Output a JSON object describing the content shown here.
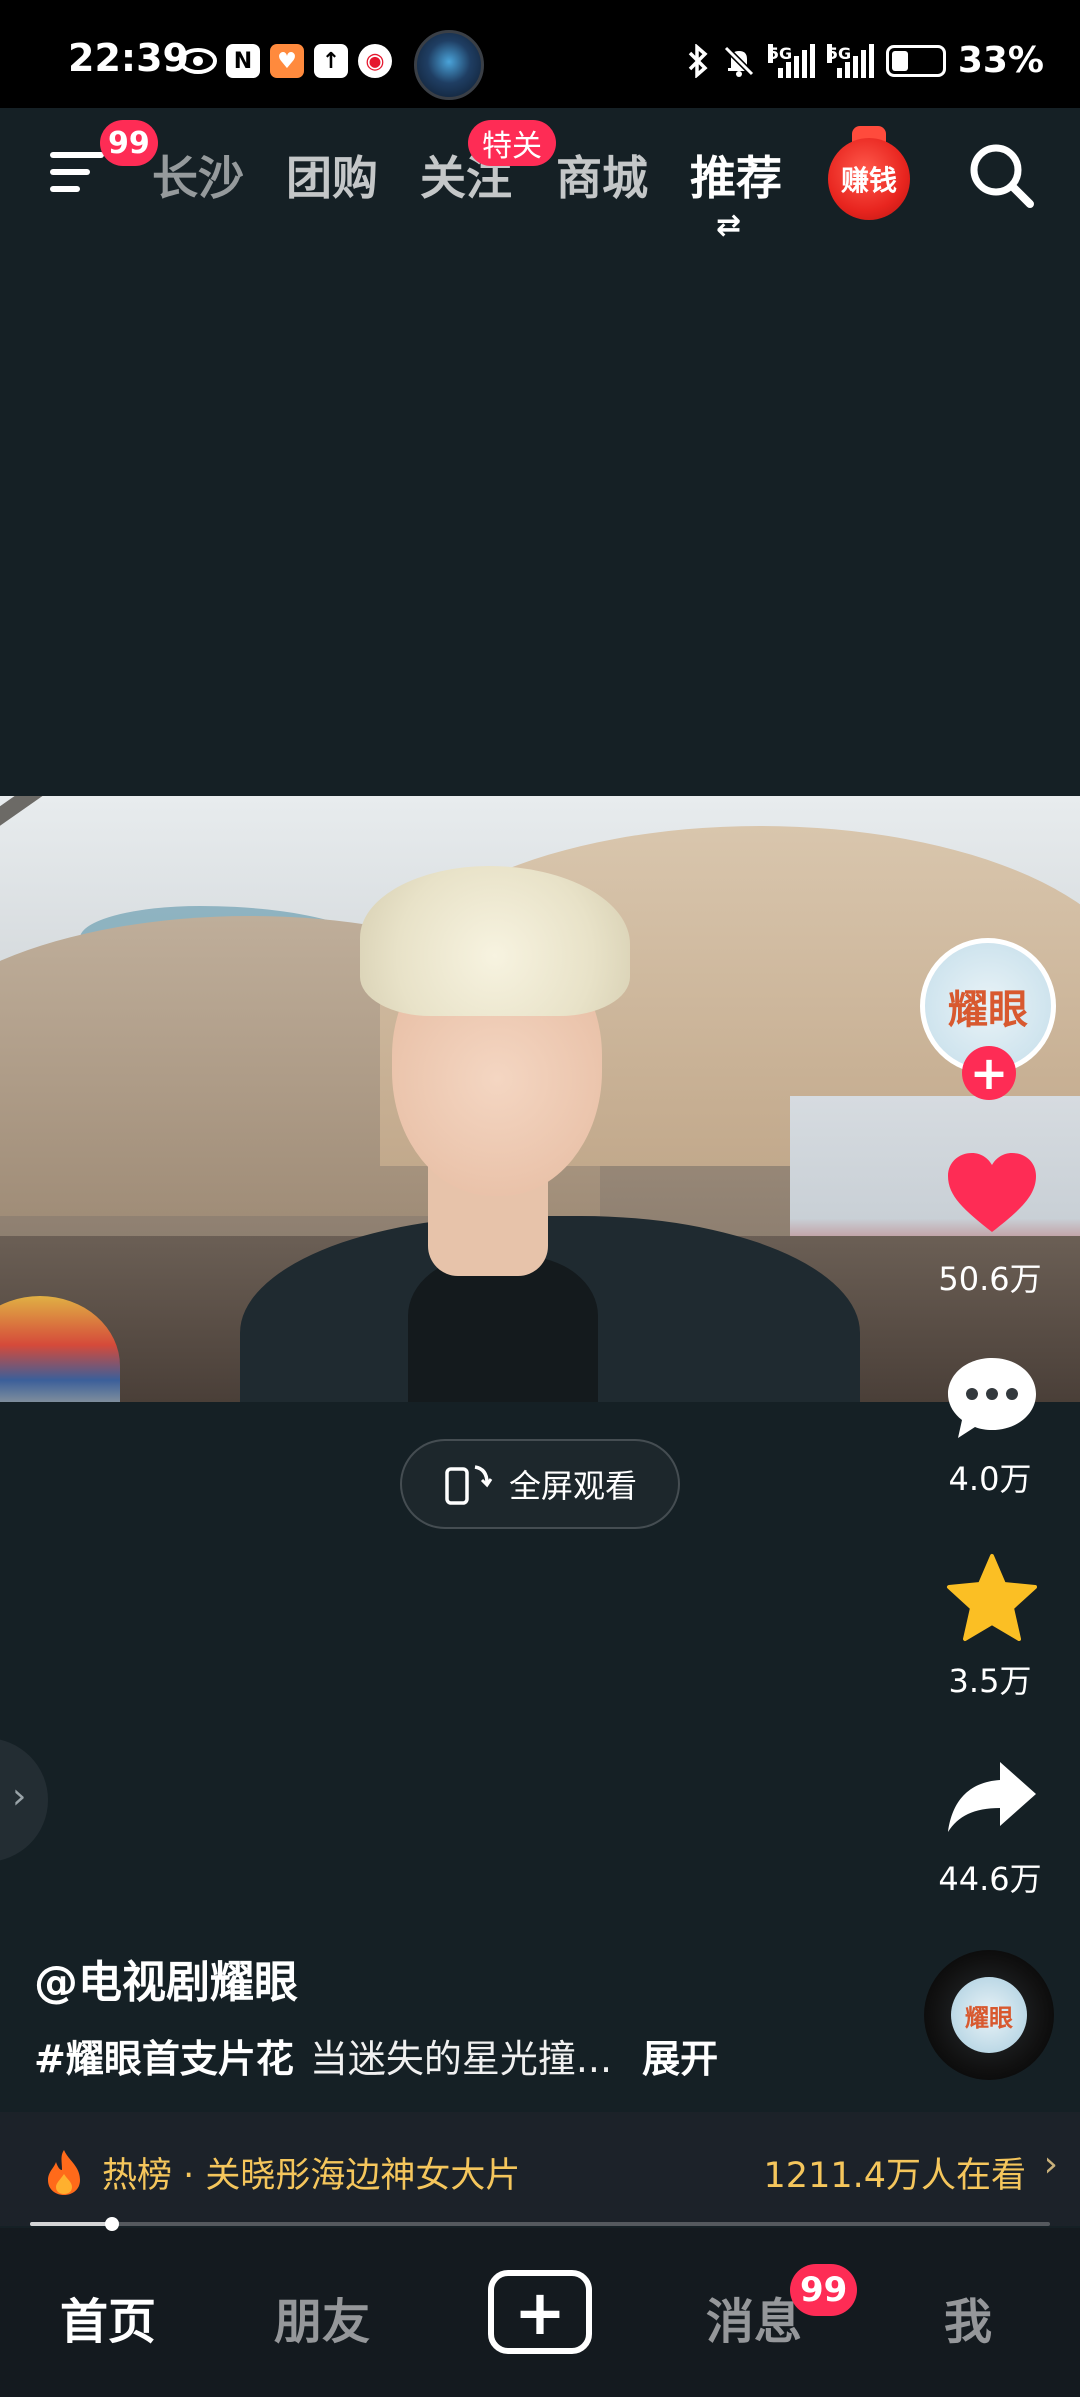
{
  "status_bar": {
    "time": "22:39",
    "battery": "33%",
    "battery_level": 0.33,
    "network_1": "5G",
    "network_2": "5G",
    "icons": [
      "eye-icon",
      "nfc-icon",
      "shop-app-icon",
      "upload-icon",
      "weibo-icon",
      "app-avatar-icon",
      "bluetooth-icon",
      "silent-icon",
      "signal-icon",
      "battery-icon"
    ]
  },
  "top_nav": {
    "menu_badge": "99",
    "tabs": [
      "长沙",
      "团购",
      "关注",
      "商城",
      "推荐"
    ],
    "follow_badge": "特关",
    "switch_glyph": "⇄",
    "earn_label": "赚钱"
  },
  "video": {
    "fullscreen_label": "全屏观看"
  },
  "actions": {
    "avatar_text": "耀眼",
    "likes": "50.6万",
    "comments": "4.0万",
    "favorites": "3.5万",
    "shares": "44.6万",
    "colors": {
      "like": "#fe2c55",
      "star": "#fbbf24",
      "follow": "#fe2c55"
    }
  },
  "caption": {
    "author": "@电视剧耀眼",
    "hashtag": "#耀眼首支片花",
    "text": "当迷失的星光撞...",
    "expand": "展开"
  },
  "music": {
    "disc_text": "耀眼"
  },
  "hot_board": {
    "text": "热榜 · 关晓彤海边神女大片",
    "viewers": "1211.4万人在看",
    "chevron": "›",
    "color": "#f5c65c"
  },
  "progress": {
    "value": 0.08
  },
  "bottom_nav": {
    "home": "首页",
    "friends": "朋友",
    "create": "+",
    "messages": "消息",
    "messages_badge": "99",
    "me": "我"
  }
}
